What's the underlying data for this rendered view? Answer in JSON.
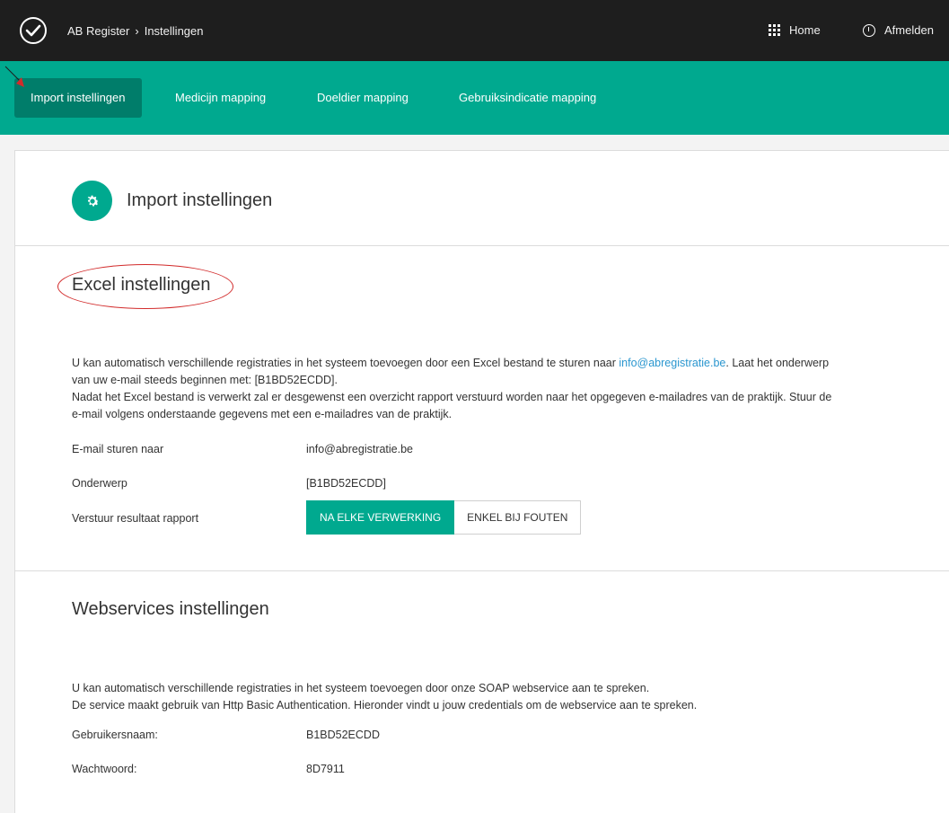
{
  "topbar": {
    "app_name": "AB Register",
    "breadcrumb_sep": "›",
    "current_page": "Instellingen",
    "home_label": "Home",
    "logout_label": "Afmelden"
  },
  "tabs": [
    {
      "label": "Import instellingen",
      "active": true
    },
    {
      "label": "Medicijn mapping",
      "active": false
    },
    {
      "label": "Doeldier mapping",
      "active": false
    },
    {
      "label": "Gebruiksindicatie mapping",
      "active": false
    }
  ],
  "page": {
    "title": "Import instellingen"
  },
  "excel": {
    "title": "Excel instellingen",
    "para1_a": "U kan automatisch verschillende registraties in het systeem toevoegen door een Excel bestand te sturen naar ",
    "para1_link": "info@abregistratie.be",
    "para1_b": ". Laat het onderwerp",
    "para1_c": "van uw e-mail steeds beginnen met: [B1BD52ECDD].",
    "para2_a": "Nadat het Excel bestand is verwerkt zal er desgewenst een overzicht rapport verstuurd worden naar het opgegeven e-mailadres van de praktijk. Stuur de",
    "para2_b": "e-mail volgens onderstaande gegevens met een e-mailadres van de praktijk.",
    "email_label": "E-mail sturen naar",
    "email_value": "info@abregistratie.be",
    "subject_label": "Onderwerp",
    "subject_value": "[B1BD52ECDD]",
    "report_label": "Verstuur resultaat rapport",
    "report_options": [
      "NA ELKE VERWERKING",
      "ENKEL BIJ FOUTEN"
    ],
    "report_selected": "NA ELKE VERWERKING"
  },
  "webservices": {
    "title": "Webservices instellingen",
    "para1": "U kan automatisch verschillende registraties in het systeem toevoegen door onze SOAP webservice aan te spreken.",
    "para2": "De service maakt gebruik van Http Basic Authentication. Hieronder vindt u jouw credentials om de webservice aan te spreken.",
    "username_label": "Gebruikersnaam:",
    "username_value": "B1BD52ECDD",
    "password_label": "Wachtwoord:",
    "password_value": "8D7911"
  },
  "colors": {
    "accent": "#00a98f",
    "accent_dark": "#007d6a",
    "topbar": "#1e1e1e",
    "link": "#2a96cf",
    "annotation": "#d22b2b"
  }
}
